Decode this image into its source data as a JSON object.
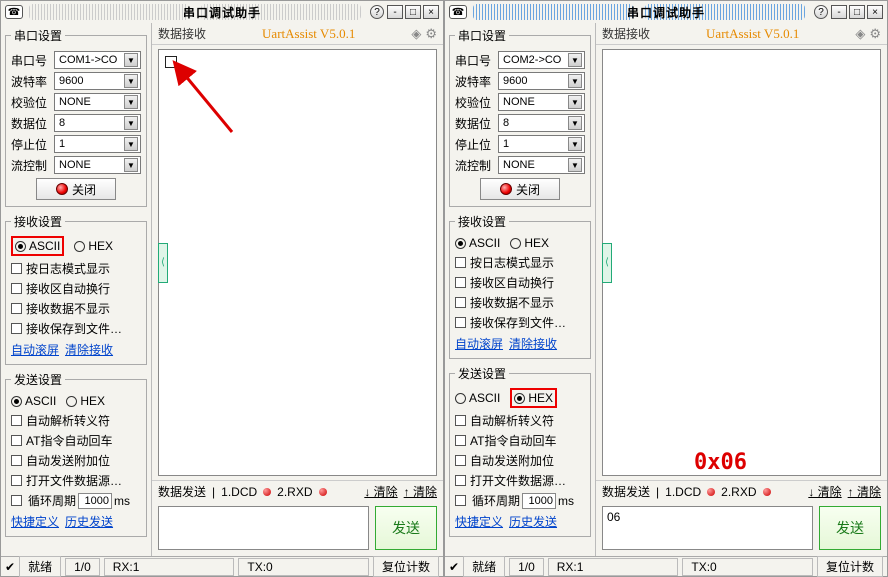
{
  "apps": [
    {
      "title": "串口调试助手",
      "brand": "UartAssist V5.0.1",
      "port_group": {
        "legend": "串口设置",
        "rows": [
          {
            "label": "串口号",
            "value": "COM1->CO"
          },
          {
            "label": "波特率",
            "value": "9600"
          },
          {
            "label": "校验位",
            "value": "NONE"
          },
          {
            "label": "数据位",
            "value": "8"
          },
          {
            "label": "停止位",
            "value": "1"
          },
          {
            "label": "流控制",
            "value": "NONE"
          }
        ],
        "close_btn": "关闭"
      },
      "rx_group": {
        "legend": "接收设置",
        "radio_ascii": "ASCII",
        "radio_hex": "HEX",
        "selected": "ascii",
        "highlight": "ascii",
        "checks": [
          "按日志模式显示",
          "接收区自动换行",
          "接收数据不显示",
          "接收保存到文件…"
        ],
        "links": [
          "自动滚屏",
          "清除接收"
        ]
      },
      "tx_group": {
        "legend": "发送设置",
        "radio_ascii": "ASCII",
        "radio_hex": "HEX",
        "selected": "ascii",
        "highlight": null,
        "checks": [
          "自动解析转义符",
          "AT指令自动回车",
          "自动发送附加位",
          "打开文件数据源…"
        ],
        "cycle_label": "循环周期",
        "cycle_val": "1000",
        "cycle_unit": "ms",
        "links": [
          "快捷定义",
          "历史发送"
        ]
      },
      "rx_title": "数据接收",
      "show_box": true,
      "txhdr": {
        "label": "数据发送",
        "dcd": "1.DCD",
        "rxd": "2.RXD",
        "clr1": "↓ 清除",
        "clr2": "↑ 清除"
      },
      "tx_value": "",
      "send_btn": "发送",
      "status": {
        "ready": "就绪",
        "count": "1/0",
        "rx": "RX:1",
        "tx": "TX:0",
        "reset": "复位计数"
      }
    },
    {
      "title": "串口调试助手",
      "brand": "UartAssist V5.0.1",
      "port_group": {
        "legend": "串口设置",
        "rows": [
          {
            "label": "串口号",
            "value": "COM2->CO"
          },
          {
            "label": "波特率",
            "value": "9600"
          },
          {
            "label": "校验位",
            "value": "NONE"
          },
          {
            "label": "数据位",
            "value": "8"
          },
          {
            "label": "停止位",
            "value": "1"
          },
          {
            "label": "流控制",
            "value": "NONE"
          }
        ],
        "close_btn": "关闭"
      },
      "rx_group": {
        "legend": "接收设置",
        "radio_ascii": "ASCII",
        "radio_hex": "HEX",
        "selected": "ascii",
        "highlight": null,
        "checks": [
          "按日志模式显示",
          "接收区自动换行",
          "接收数据不显示",
          "接收保存到文件…"
        ],
        "links": [
          "自动滚屏",
          "清除接收"
        ]
      },
      "tx_group": {
        "legend": "发送设置",
        "radio_ascii": "ASCII",
        "radio_hex": "HEX",
        "selected": "hex",
        "highlight": "hex",
        "checks": [
          "自动解析转义符",
          "AT指令自动回车",
          "自动发送附加位",
          "打开文件数据源…"
        ],
        "cycle_label": "循环周期",
        "cycle_val": "1000",
        "cycle_unit": "ms",
        "links": [
          "快捷定义",
          "历史发送"
        ]
      },
      "rx_title": "数据接收",
      "show_box": false,
      "txhdr": {
        "label": "数据发送",
        "dcd": "1.DCD",
        "rxd": "2.RXD",
        "clr1": "↓ 清除",
        "clr2": "↑ 清除"
      },
      "tx_value": "06",
      "send_btn": "发送",
      "status": {
        "ready": "就绪",
        "count": "1/0",
        "rx": "RX:1",
        "tx": "TX:0",
        "reset": "复位计数"
      }
    }
  ],
  "annotation": "0x06"
}
